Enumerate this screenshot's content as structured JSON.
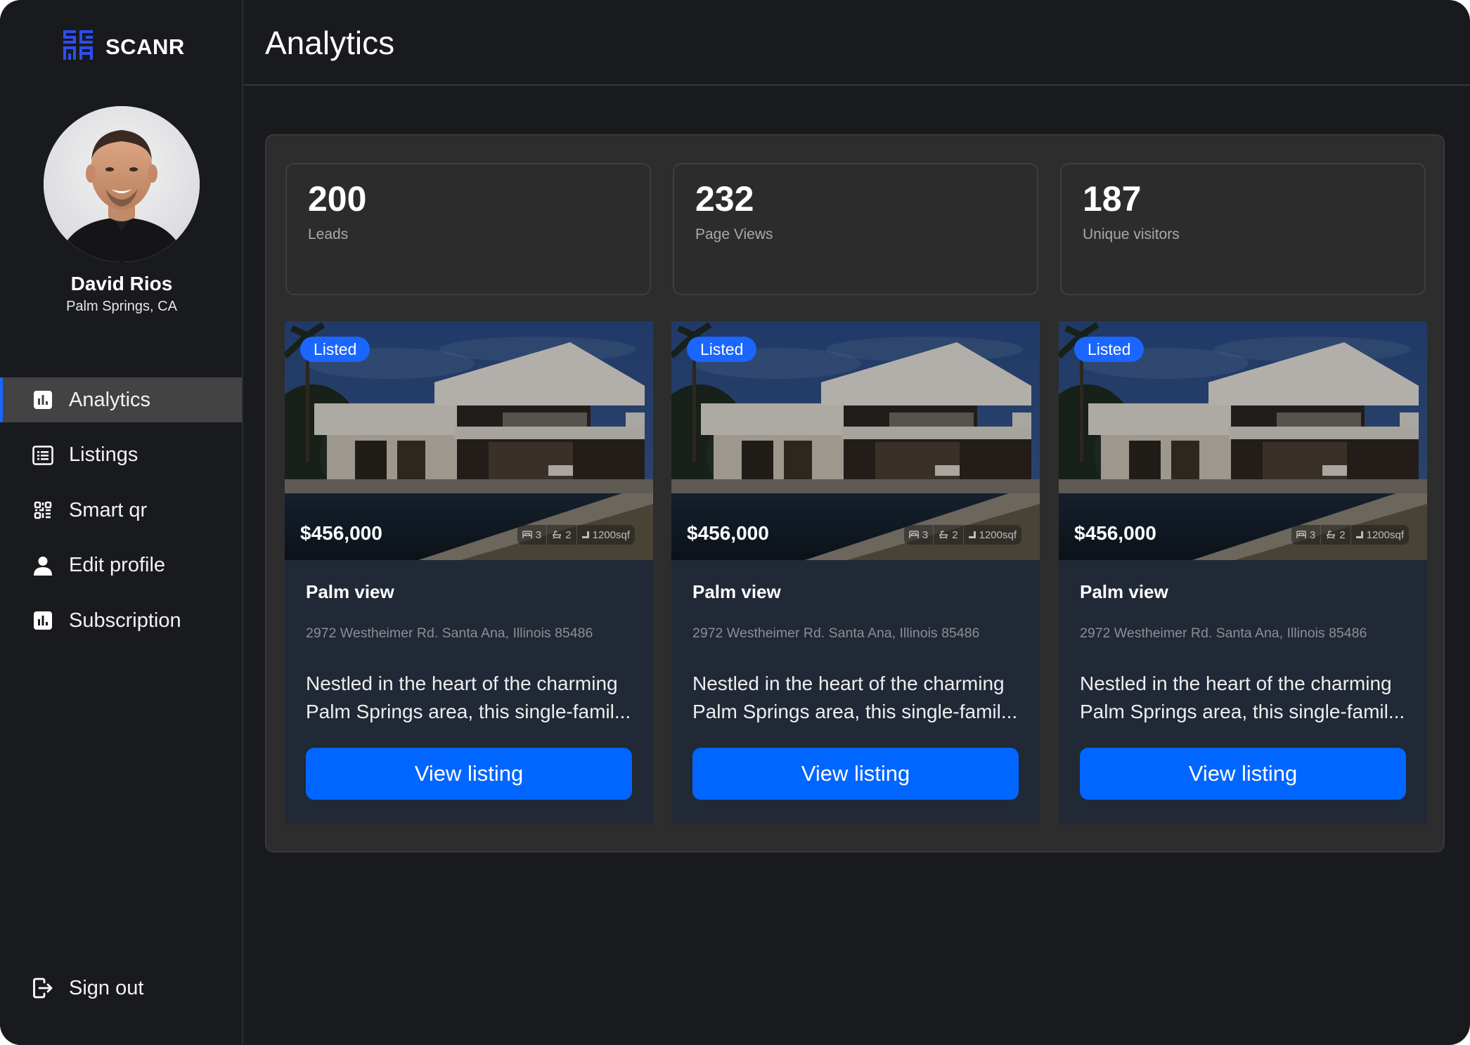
{
  "brand": {
    "name": "SCANR",
    "accent": "#2e4ef0"
  },
  "user": {
    "name": "David Rios",
    "location": "Palm Springs, CA"
  },
  "nav": {
    "items": [
      {
        "id": "analytics",
        "label": "Analytics",
        "icon": "bar-chart-icon",
        "active": true
      },
      {
        "id": "listings",
        "label": "Listings",
        "icon": "list-icon",
        "active": false
      },
      {
        "id": "smart-qr",
        "label": "Smart qr",
        "icon": "qr-code-icon",
        "active": false
      },
      {
        "id": "edit-profile",
        "label": "Edit profile",
        "icon": "user-icon",
        "active": false
      },
      {
        "id": "subscription",
        "label": "Subscription",
        "icon": "bar-chart-icon",
        "active": false
      }
    ],
    "signout_label": "Sign out"
  },
  "header": {
    "title": "Analytics"
  },
  "stats": [
    {
      "value": "200",
      "label": "Leads"
    },
    {
      "value": "232",
      "label": "Page Views"
    },
    {
      "value": "187",
      "label": "Unique visitors"
    }
  ],
  "listings": [
    {
      "badge": "Listed",
      "price": "$456,000",
      "beds": "3",
      "baths": "2",
      "area": "1200sqf",
      "title": "Palm view",
      "address": "2972 Westheimer Rd. Santa Ana, Illinois 85486",
      "desc_line1": "Nestled in the heart of the charming",
      "desc_line2": "Palm Springs area, this single-famil...",
      "button": "View listing"
    },
    {
      "badge": "Listed",
      "price": "$456,000",
      "beds": "3",
      "baths": "2",
      "area": "1200sqf",
      "title": "Palm view",
      "address": "2972 Westheimer Rd. Santa Ana, Illinois 85486",
      "desc_line1": "Nestled in the heart of the charming",
      "desc_line2": "Palm Springs area, this single-famil...",
      "button": "View listing"
    },
    {
      "badge": "Listed",
      "price": "$456,000",
      "beds": "3",
      "baths": "2",
      "area": "1200sqf",
      "title": "Palm view",
      "address": "2972 Westheimer Rd. Santa Ana, Illinois 85486",
      "desc_line1": "Nestled in the heart of the charming",
      "desc_line2": "Palm Springs area, this single-famil...",
      "button": "View listing"
    }
  ],
  "colors": {
    "background": "#191a1e",
    "panel": "#2d2d2d",
    "card": "#212836",
    "primary_button": "#0066ff",
    "badge": "#1a66ff",
    "active_nav": "#434343"
  }
}
